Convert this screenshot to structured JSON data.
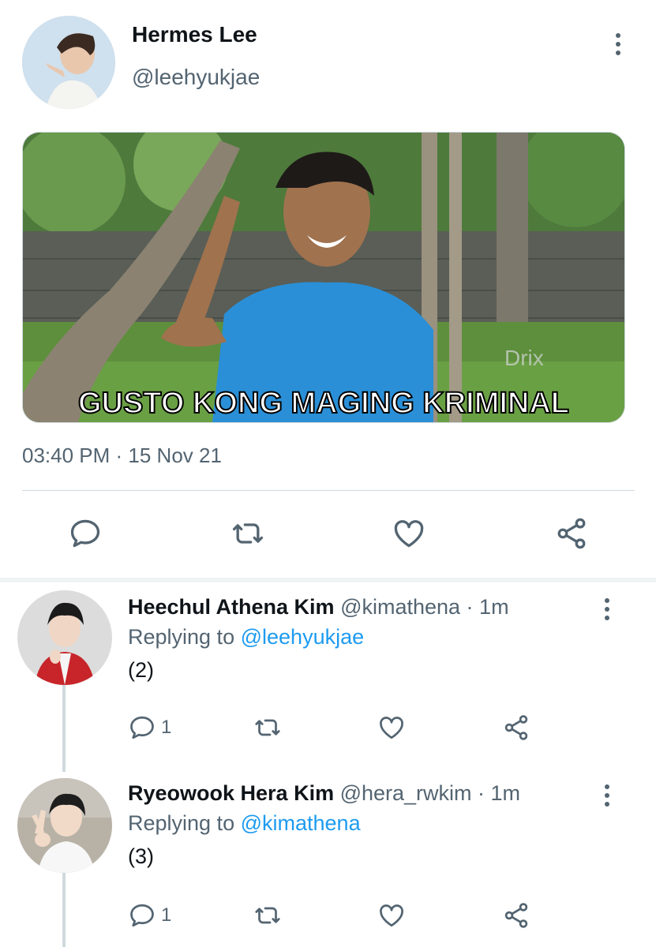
{
  "tweet": {
    "display_name": "Hermes Lee",
    "handle": "@leehyukjae",
    "media_caption": "GUSTO KONG MAGING KRIMINAL",
    "media_watermark": "Drix",
    "timestamp": "03:40 PM · 15 Nov 21"
  },
  "actions": {
    "reply_icon": "reply-icon",
    "retweet_icon": "retweet-icon",
    "like_icon": "heart-icon",
    "share_icon": "share-icon"
  },
  "replies": [
    {
      "name": "Heechul Athena Kim",
      "handle": "@kimathena · 1m",
      "replying_prefix": "Replying to",
      "replying_to": "@leehyukjae",
      "body": "(2)",
      "reply_count": "1"
    },
    {
      "name": "Ryeowook Hera Kim",
      "handle": "@hera_rwkim · 1m",
      "replying_prefix": "Replying to",
      "replying_to": "@kimathena",
      "body": "(3)",
      "reply_count": "1"
    }
  ],
  "colors": {
    "link": "#1d9bf0",
    "muted": "#536471",
    "text": "#0f1419"
  }
}
